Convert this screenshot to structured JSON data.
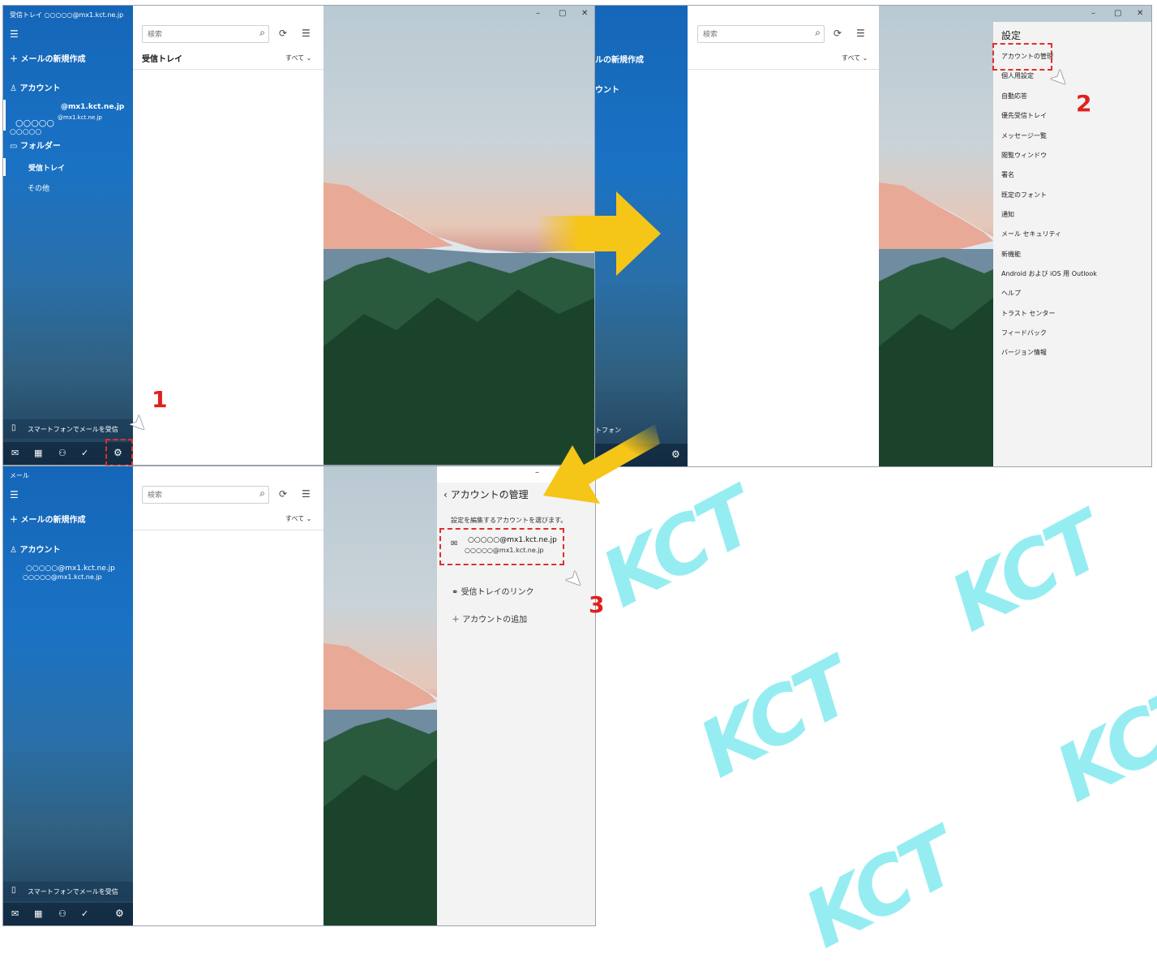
{
  "watermark": "KCT",
  "shot1": {
    "window_title": "受信トレイ ○○○○○@mx1.kct.ne.jp",
    "new_mail": "メールの新規作成",
    "account_header": "アカウント",
    "account_email": "@mx1.kct.ne.jp",
    "account_email_sub": "@mx1.kct.ne.jp",
    "account_name": "○○○○○",
    "account_name2": "○○○○○",
    "folder_header": "フォルダー",
    "folder_inbox": "受信トレイ",
    "folder_other": "その他",
    "search_placeholder": "検索",
    "list_title": "受信トレイ",
    "filter": "すべて",
    "phone_mail": "スマートフォンでメールを受信",
    "step": "1"
  },
  "shot2": {
    "new_mail_partial": "ルの新規作成",
    "account_partial": "ウント",
    "phone_partial": "トフォン",
    "search_placeholder": "検索",
    "filter": "すべて",
    "settings_title": "設定",
    "settings_items": [
      "アカウントの管理",
      "個人用設定",
      "自動応答",
      "優先受信トレイ",
      "メッセージ一覧",
      "閲覧ウィンドウ",
      "署名",
      "既定のフォント",
      "通知",
      "メール セキュリティ",
      "新機能",
      "Android および iOS 用 Outlook",
      "ヘルプ",
      "トラスト センター",
      "フィードバック",
      "バージョン情報"
    ],
    "step": "2"
  },
  "shot3": {
    "window_title": "メール",
    "new_mail": "メールの新規作成",
    "account_header": "アカウント",
    "account_email": "○○○○○@mx1.kct.ne.jp",
    "account_email_sub": "○○○○○@mx1.kct.ne.jp",
    "search_placeholder": "検索",
    "filter": "すべて",
    "phone_mail": "スマートフォンでメールを受信",
    "panel_title": "アカウントの管理",
    "panel_desc": "設定を編集するアカウントを選びます。",
    "panel_account_email": "○○○○○@mx1.kct.ne.jp",
    "panel_account_sub": "○○○○○@mx1.kct.ne.jp",
    "panel_link_inbox": "受信トレイのリンク",
    "panel_add_account": "アカウントの追加",
    "step": "3"
  },
  "colors": {
    "accent": "#1a72c4",
    "highlight": "#e22d2d",
    "arrow": "#f5c518",
    "watermark": "#40e0e8"
  }
}
